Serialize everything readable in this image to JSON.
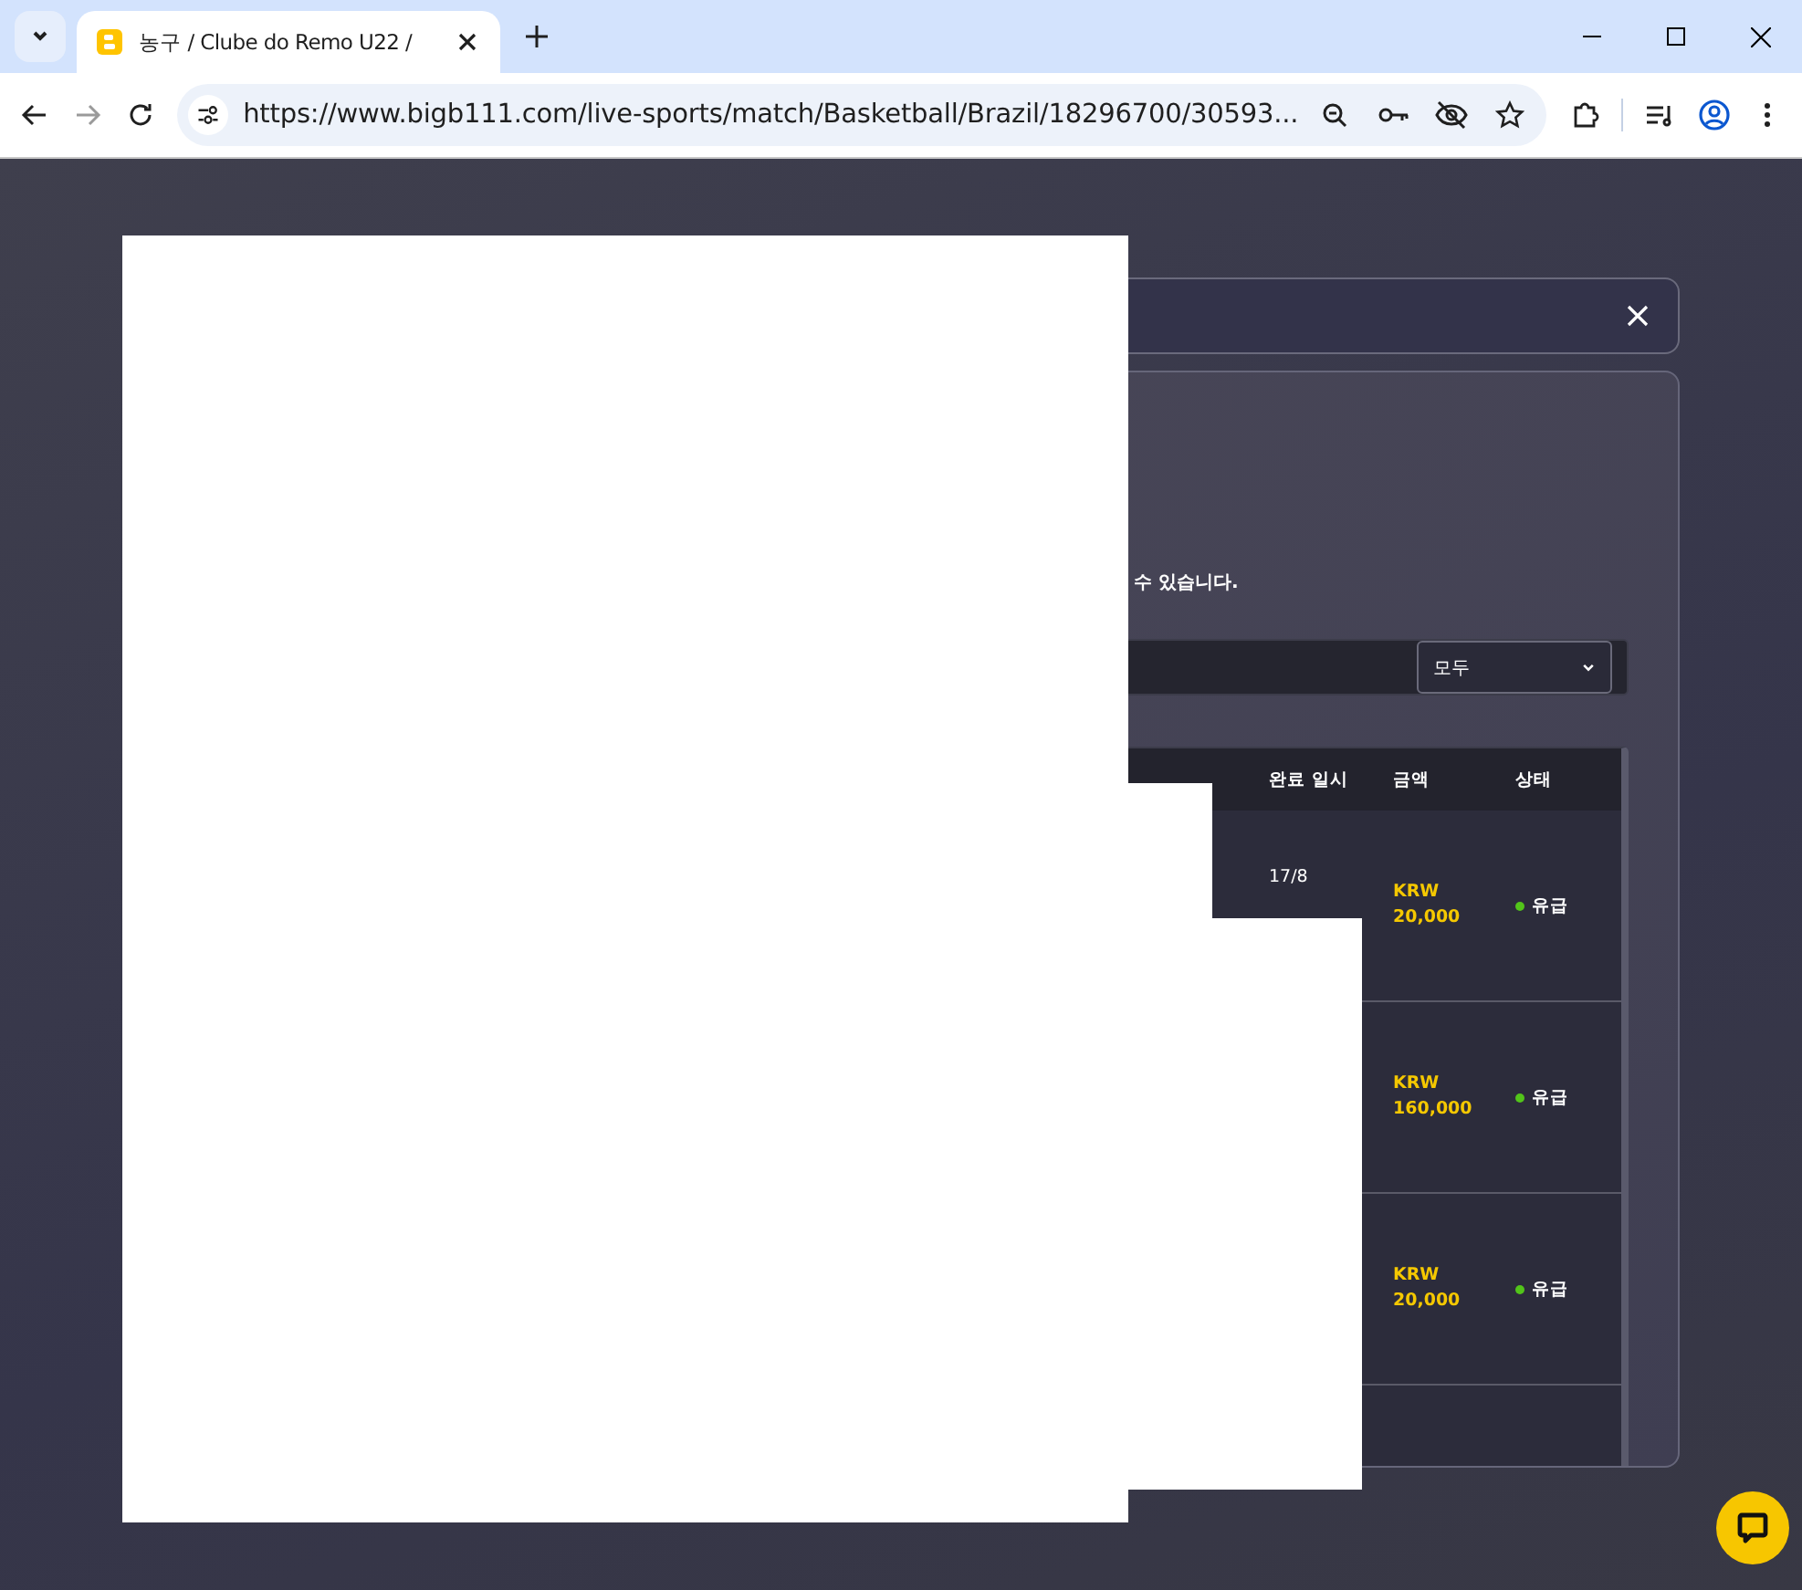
{
  "browser": {
    "tab_title": "농구 / Clube do Remo U22 /",
    "url": "https://www.bigb111.com/live-sports/match/Basketball/Brazil/18296700/30593..."
  },
  "modal": {
    "notice": "수 있습니다.",
    "filter": {
      "value": "모두"
    },
    "table": {
      "columns": [
        "완료 일시",
        "금액",
        "상태"
      ],
      "rows": [
        {
          "date": "17/8",
          "currency": "KRW",
          "amount": "20,000",
          "status": "유급",
          "color": "#52c41a"
        },
        {
          "currency": "KRW",
          "amount": "160,000",
          "status": "유급",
          "color": "#52c41a"
        },
        {
          "currency": "KRW",
          "amount": "20,000",
          "status": "유급",
          "color": "#52c41a"
        }
      ]
    }
  }
}
